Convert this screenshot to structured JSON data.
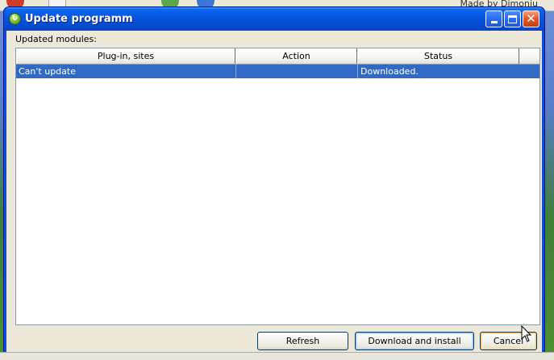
{
  "background": {
    "app_text": "Made by Dimoniu"
  },
  "window": {
    "title": "Update programm",
    "icon": "globe-update-icon",
    "controls": {
      "minimize": "minimize-icon",
      "maximize": "maximize-icon",
      "close": "close-icon"
    }
  },
  "modules": {
    "label": "Updated modules:",
    "columns": [
      "Plug-in, sites",
      "Action",
      "Status"
    ],
    "rows": [
      {
        "plugin": "Can't update",
        "action": "",
        "status": "Downloaded.",
        "selected": true
      }
    ]
  },
  "buttons": {
    "refresh": "Refresh",
    "download_install": "Download and install",
    "cancel": "Cancel"
  },
  "colors": {
    "titlebar": "#0653d9",
    "selection": "#316ac5",
    "dialog_bg": "#ece9d8"
  }
}
